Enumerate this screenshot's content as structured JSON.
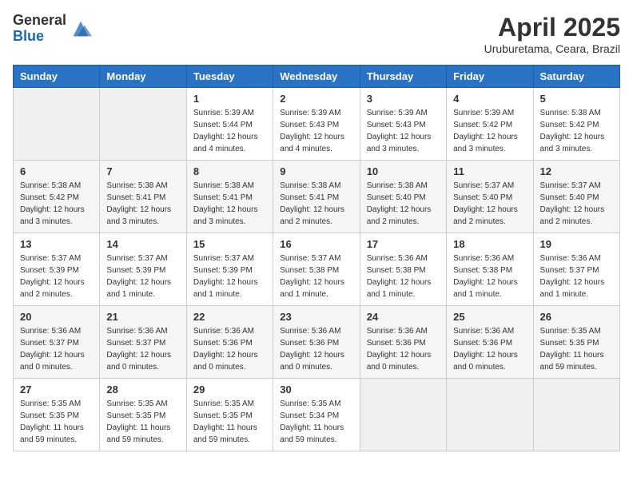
{
  "header": {
    "logo_general": "General",
    "logo_blue": "Blue",
    "title": "April 2025",
    "location": "Uruburetama, Ceara, Brazil"
  },
  "calendar": {
    "days_of_week": [
      "Sunday",
      "Monday",
      "Tuesday",
      "Wednesday",
      "Thursday",
      "Friday",
      "Saturday"
    ],
    "weeks": [
      [
        {
          "day": "",
          "info": ""
        },
        {
          "day": "",
          "info": ""
        },
        {
          "day": "1",
          "info": "Sunrise: 5:39 AM\nSunset: 5:44 PM\nDaylight: 12 hours\nand 4 minutes."
        },
        {
          "day": "2",
          "info": "Sunrise: 5:39 AM\nSunset: 5:43 PM\nDaylight: 12 hours\nand 4 minutes."
        },
        {
          "day": "3",
          "info": "Sunrise: 5:39 AM\nSunset: 5:43 PM\nDaylight: 12 hours\nand 3 minutes."
        },
        {
          "day": "4",
          "info": "Sunrise: 5:39 AM\nSunset: 5:42 PM\nDaylight: 12 hours\nand 3 minutes."
        },
        {
          "day": "5",
          "info": "Sunrise: 5:38 AM\nSunset: 5:42 PM\nDaylight: 12 hours\nand 3 minutes."
        }
      ],
      [
        {
          "day": "6",
          "info": "Sunrise: 5:38 AM\nSunset: 5:42 PM\nDaylight: 12 hours\nand 3 minutes."
        },
        {
          "day": "7",
          "info": "Sunrise: 5:38 AM\nSunset: 5:41 PM\nDaylight: 12 hours\nand 3 minutes."
        },
        {
          "day": "8",
          "info": "Sunrise: 5:38 AM\nSunset: 5:41 PM\nDaylight: 12 hours\nand 3 minutes."
        },
        {
          "day": "9",
          "info": "Sunrise: 5:38 AM\nSunset: 5:41 PM\nDaylight: 12 hours\nand 2 minutes."
        },
        {
          "day": "10",
          "info": "Sunrise: 5:38 AM\nSunset: 5:40 PM\nDaylight: 12 hours\nand 2 minutes."
        },
        {
          "day": "11",
          "info": "Sunrise: 5:37 AM\nSunset: 5:40 PM\nDaylight: 12 hours\nand 2 minutes."
        },
        {
          "day": "12",
          "info": "Sunrise: 5:37 AM\nSunset: 5:40 PM\nDaylight: 12 hours\nand 2 minutes."
        }
      ],
      [
        {
          "day": "13",
          "info": "Sunrise: 5:37 AM\nSunset: 5:39 PM\nDaylight: 12 hours\nand 2 minutes."
        },
        {
          "day": "14",
          "info": "Sunrise: 5:37 AM\nSunset: 5:39 PM\nDaylight: 12 hours\nand 1 minute."
        },
        {
          "day": "15",
          "info": "Sunrise: 5:37 AM\nSunset: 5:39 PM\nDaylight: 12 hours\nand 1 minute."
        },
        {
          "day": "16",
          "info": "Sunrise: 5:37 AM\nSunset: 5:38 PM\nDaylight: 12 hours\nand 1 minute."
        },
        {
          "day": "17",
          "info": "Sunrise: 5:36 AM\nSunset: 5:38 PM\nDaylight: 12 hours\nand 1 minute."
        },
        {
          "day": "18",
          "info": "Sunrise: 5:36 AM\nSunset: 5:38 PM\nDaylight: 12 hours\nand 1 minute."
        },
        {
          "day": "19",
          "info": "Sunrise: 5:36 AM\nSunset: 5:37 PM\nDaylight: 12 hours\nand 1 minute."
        }
      ],
      [
        {
          "day": "20",
          "info": "Sunrise: 5:36 AM\nSunset: 5:37 PM\nDaylight: 12 hours\nand 0 minutes."
        },
        {
          "day": "21",
          "info": "Sunrise: 5:36 AM\nSunset: 5:37 PM\nDaylight: 12 hours\nand 0 minutes."
        },
        {
          "day": "22",
          "info": "Sunrise: 5:36 AM\nSunset: 5:36 PM\nDaylight: 12 hours\nand 0 minutes."
        },
        {
          "day": "23",
          "info": "Sunrise: 5:36 AM\nSunset: 5:36 PM\nDaylight: 12 hours\nand 0 minutes."
        },
        {
          "day": "24",
          "info": "Sunrise: 5:36 AM\nSunset: 5:36 PM\nDaylight: 12 hours\nand 0 minutes."
        },
        {
          "day": "25",
          "info": "Sunrise: 5:36 AM\nSunset: 5:36 PM\nDaylight: 12 hours\nand 0 minutes."
        },
        {
          "day": "26",
          "info": "Sunrise: 5:35 AM\nSunset: 5:35 PM\nDaylight: 11 hours\nand 59 minutes."
        }
      ],
      [
        {
          "day": "27",
          "info": "Sunrise: 5:35 AM\nSunset: 5:35 PM\nDaylight: 11 hours\nand 59 minutes."
        },
        {
          "day": "28",
          "info": "Sunrise: 5:35 AM\nSunset: 5:35 PM\nDaylight: 11 hours\nand 59 minutes."
        },
        {
          "day": "29",
          "info": "Sunrise: 5:35 AM\nSunset: 5:35 PM\nDaylight: 11 hours\nand 59 minutes."
        },
        {
          "day": "30",
          "info": "Sunrise: 5:35 AM\nSunset: 5:34 PM\nDaylight: 11 hours\nand 59 minutes."
        },
        {
          "day": "",
          "info": ""
        },
        {
          "day": "",
          "info": ""
        },
        {
          "day": "",
          "info": ""
        }
      ]
    ]
  }
}
